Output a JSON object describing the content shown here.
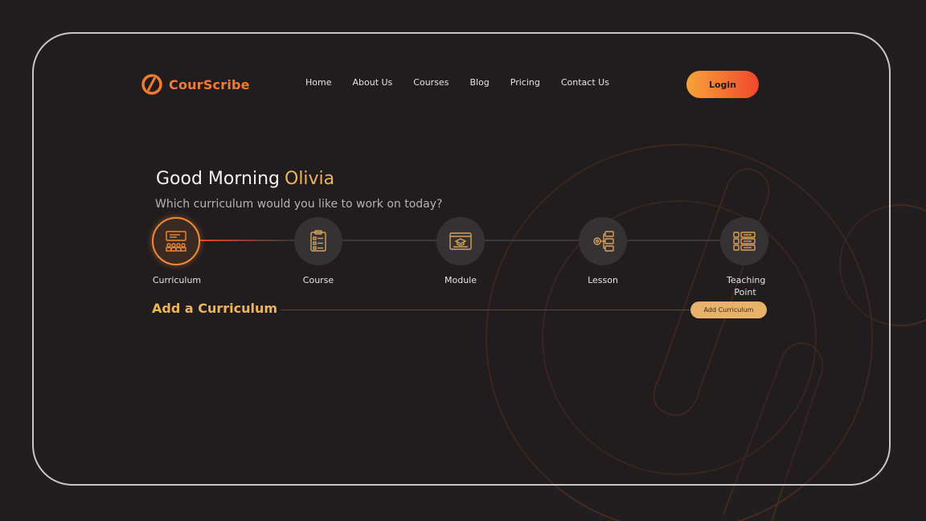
{
  "brand": {
    "name": "CourScribe",
    "logo_icon": "courscribe-logo-icon"
  },
  "nav": {
    "items": [
      "Home",
      "About Us",
      "Courses",
      "Blog",
      "Pricing",
      "Contact Us"
    ]
  },
  "login_label": "Login",
  "greeting": {
    "prefix": "Good Morning",
    "name": "Olivia"
  },
  "subtitle": "Which curriculum would you like to work on today?",
  "steps": [
    {
      "label": "Curriculum",
      "icon": "curriculum-icon",
      "active": true
    },
    {
      "label": "Course",
      "icon": "course-icon",
      "active": false
    },
    {
      "label": "Module",
      "icon": "module-icon",
      "active": false
    },
    {
      "label": "Lesson",
      "icon": "lesson-icon",
      "active": false
    },
    {
      "label": "Teaching Point",
      "icon": "teaching-point-icon",
      "active": false
    }
  ],
  "add_section": {
    "title": "Add a Curriculum",
    "button_label": "Add Curriculum"
  },
  "colors": {
    "accent": "#f47a2c",
    "gold": "#f0b456",
    "background": "#211e1f"
  }
}
